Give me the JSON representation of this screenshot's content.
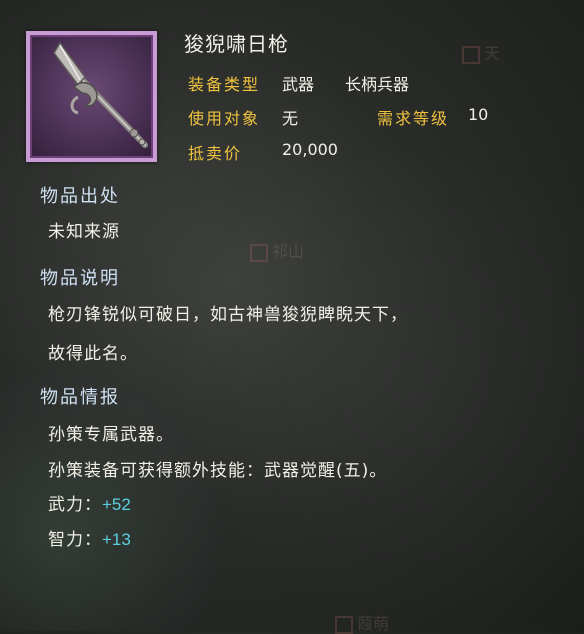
{
  "item": {
    "name": "狻猊啸日枪",
    "icon": "spear-icon",
    "fields": {
      "type_label": "装备类型",
      "type_value": "武器",
      "type_sub": "长柄兵器",
      "user_label": "使用对象",
      "user_value": "无",
      "level_label": "需求等级",
      "level_value": "10",
      "price_label": "抵卖价",
      "price_value": "20,000"
    }
  },
  "sections": {
    "origin_title": "物品出处",
    "origin_text": "未知来源",
    "desc_title": "物品说明",
    "desc_line1": "枪刃锋锐似可破日，如古神兽狻猊睥睨天下，",
    "desc_line2": "故得此名。",
    "info_title": "物品情报",
    "info_line1": "孙策专属武器。",
    "info_line2": "孙策装备可获得额外技能：武器觉醒(五)。",
    "stat1_label": "武力：",
    "stat1_value": "+52",
    "stat2_label": "智力：",
    "stat2_value": "+13"
  },
  "colors": {
    "label": "#f0c23e",
    "section": "#cfe0f2",
    "stat": "#5ccfe0",
    "frame": "#c79bd4"
  }
}
